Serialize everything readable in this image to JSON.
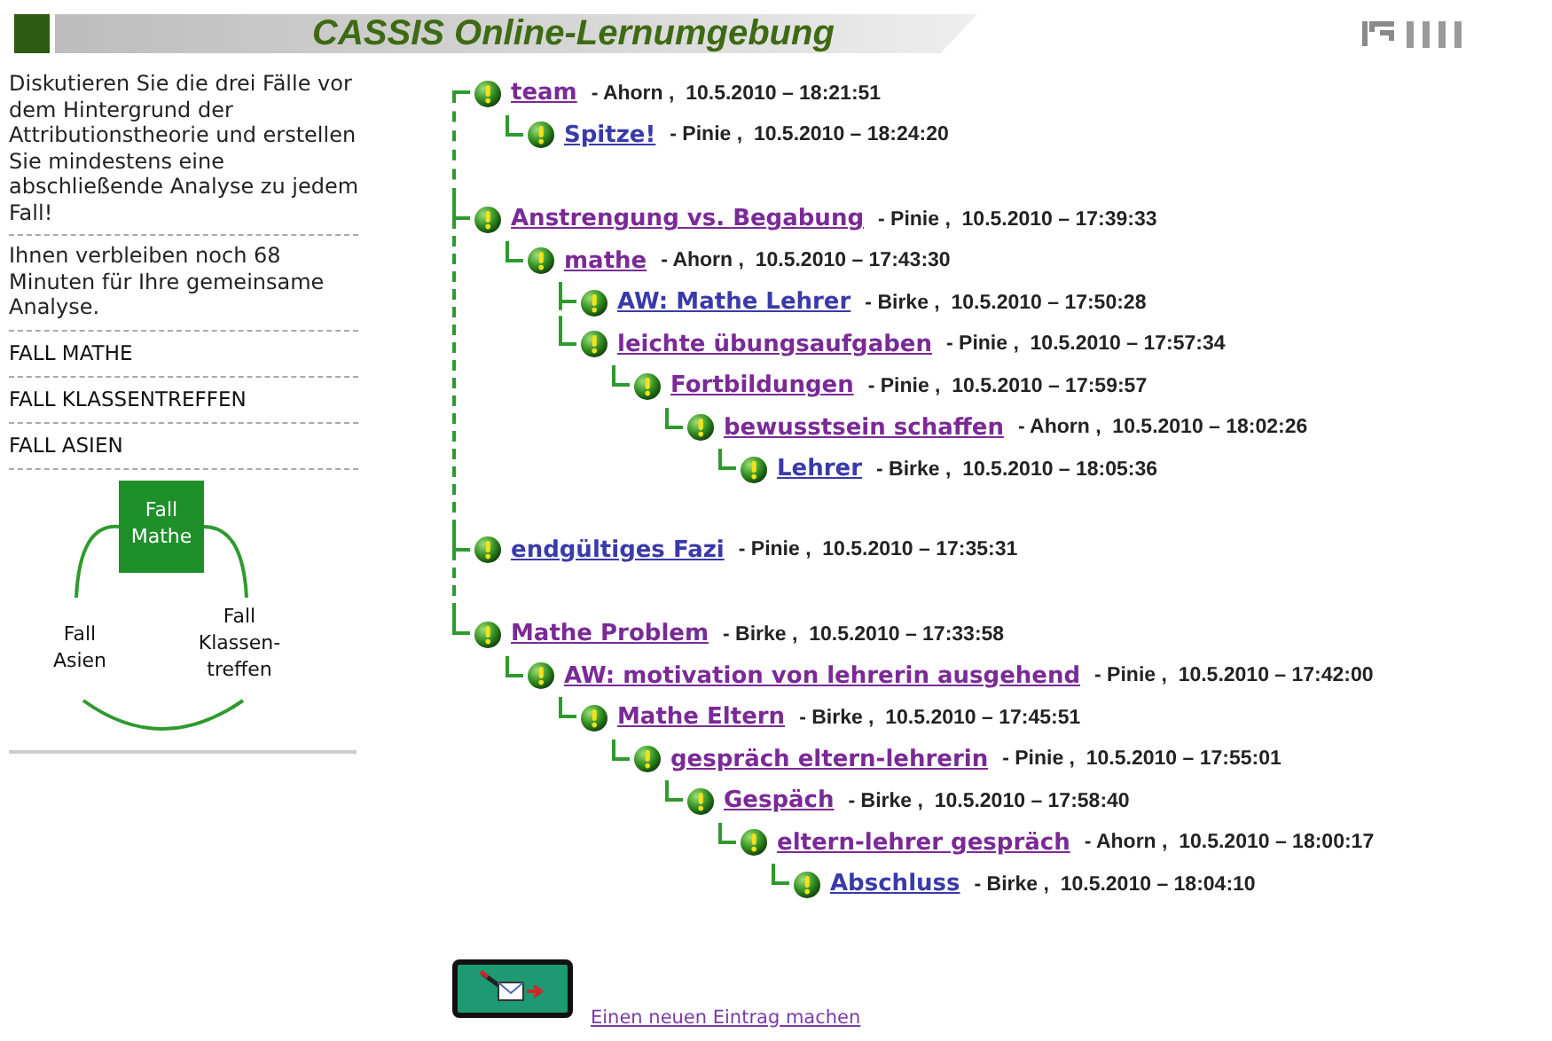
{
  "header": {
    "title": "CASSIS Online-Lernumgebung"
  },
  "sidebar": {
    "task": "Diskutieren Sie die drei Fälle vor dem Hintergrund der Attributionstheorie und erstellen Sie mindestens eine abschließende Analyse zu jedem Fall!",
    "time_note": "Ihnen verbleiben noch 68 Minuten für Ihre gemeinsame Analyse.",
    "cases": [
      "FALL MATHE",
      "FALL KLASSENTREFFEN",
      "FALL ASIEN"
    ],
    "diagram": {
      "top": [
        "Fall",
        "Mathe"
      ],
      "left": [
        "Fall",
        "Asien"
      ],
      "right": [
        "Fall",
        "Klassen-",
        "treffen"
      ]
    }
  },
  "threads": [
    {
      "title": "team",
      "visited": true,
      "meta": "- Ahorn ,  10.5.2010 – 18:21:51",
      "children": [
        {
          "title": "Spitze!",
          "visited": false,
          "meta": "- Pinie ,  10.5.2010 – 18:24:20"
        }
      ]
    },
    {
      "title": "Anstrengung vs. Begabung",
      "visited": true,
      "meta": "- Pinie ,  10.5.2010 – 17:39:33",
      "children": [
        {
          "title": "mathe",
          "visited": true,
          "meta": "- Ahorn ,  10.5.2010 – 17:43:30",
          "children": [
            {
              "title": "AW: Mathe Lehrer",
              "visited": false,
              "meta": "- Birke ,  10.5.2010 – 17:50:28"
            },
            {
              "title": "leichte übungsaufgaben",
              "visited": true,
              "meta": "- Pinie ,  10.5.2010 – 17:57:34",
              "children": [
                {
                  "title": "Fortbildungen",
                  "visited": true,
                  "meta": "- Pinie ,  10.5.2010 – 17:59:57",
                  "children": [
                    {
                      "title": "bewusstsein schaffen",
                      "visited": true,
                      "meta": "- Ahorn ,  10.5.2010 – 18:02:26",
                      "children": [
                        {
                          "title": "Lehrer",
                          "visited": false,
                          "meta": "- Birke ,  10.5.2010 – 18:05:36"
                        }
                      ]
                    }
                  ]
                }
              ]
            }
          ]
        }
      ]
    },
    {
      "title": "endgültiges Fazi",
      "visited": false,
      "meta": "- Pinie ,  10.5.2010 – 17:35:31"
    },
    {
      "title": "Mathe Problem",
      "visited": true,
      "meta": "- Birke ,  10.5.2010 – 17:33:58",
      "children": [
        {
          "title": "AW: motivation von lehrerin ausgehend",
          "visited": true,
          "meta": "- Pinie ,  10.5.2010 – 17:42:00",
          "children": [
            {
              "title": "Mathe Eltern",
              "visited": true,
              "meta": "- Birke ,  10.5.2010 – 17:45:51",
              "children": [
                {
                  "title": "gespräch eltern-lehrerin",
                  "visited": true,
                  "meta": "- Pinie ,  10.5.2010 – 17:55:01",
                  "children": [
                    {
                      "title": "Gespäch",
                      "visited": true,
                      "meta": "- Birke ,  10.5.2010 – 17:58:40",
                      "children": [
                        {
                          "title": "eltern-lehrer gespräch",
                          "visited": true,
                          "meta": "- Ahorn ,  10.5.2010 – 18:00:17",
                          "children": [
                            {
                              "title": "Abschluss",
                              "visited": false,
                              "meta": "- Birke ,  10.5.2010 – 18:04:10"
                            }
                          ]
                        }
                      ]
                    }
                  ]
                }
              ]
            }
          ]
        }
      ]
    }
  ],
  "new_entry": {
    "link": "Einen neuen Eintrag machen"
  }
}
